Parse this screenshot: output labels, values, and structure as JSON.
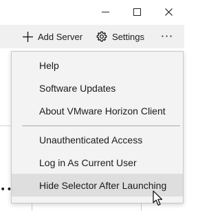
{
  "window": {
    "minimize_symbol": "–",
    "maximize_symbol": "□",
    "close_symbol": "✕"
  },
  "toolbar": {
    "add_server_icon": "plus-icon",
    "add_server_label": "Add Server",
    "settings_icon": "gear-icon",
    "settings_label": "Settings",
    "more_icon": "more-horizontal-icon",
    "more_label": "···"
  },
  "menu": {
    "group1": [
      {
        "label": "Help"
      },
      {
        "label": "Software Updates"
      },
      {
        "label": "About VMware Horizon Client"
      }
    ],
    "group2": [
      {
        "label": "Unauthenticated Access"
      },
      {
        "label": "Log in As Current User"
      },
      {
        "label": "Hide Selector After Launching"
      }
    ],
    "hovered_item": "Hide Selector After Launching"
  },
  "background": {
    "dots": "•••"
  },
  "colors": {
    "toolbar_bg": "#f0f0f0",
    "menu_bg": "#f3f3f3",
    "menu_hover": "#dedede",
    "separator": "#a8a8a8"
  }
}
